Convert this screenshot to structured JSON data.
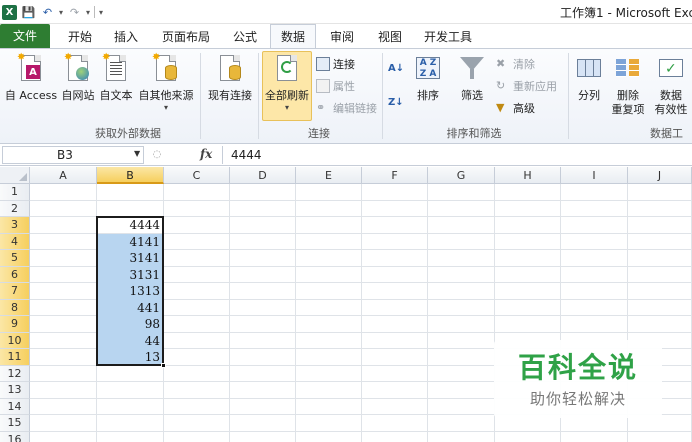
{
  "window": {
    "title": "工作簿1 - Microsoft Exce"
  },
  "qat": {
    "logo_letter": "X"
  },
  "tabs": [
    {
      "label": "文件",
      "kind": "file"
    },
    {
      "label": "开始"
    },
    {
      "label": "插入"
    },
    {
      "label": "页面布局"
    },
    {
      "label": "公式"
    },
    {
      "label": "数据",
      "active": true
    },
    {
      "label": "审阅"
    },
    {
      "label": "视图"
    },
    {
      "label": "开发工具"
    }
  ],
  "ribbon": {
    "external": {
      "access": "自 Access",
      "web": "自网站",
      "text": "自文本",
      "other": "自其他来源",
      "existing": "现有连接",
      "group": "获取外部数据"
    },
    "connections": {
      "refresh_all": "全部刷新",
      "connections": "连接",
      "properties": "属性",
      "edit_links": "编辑链接",
      "group": "连接"
    },
    "sort_filter": {
      "sort": "排序",
      "filter": "筛选",
      "clear": "清除",
      "reapply": "重新应用",
      "advanced": "高级",
      "group": "排序和筛选"
    },
    "data_tools": {
      "text_to_columns": "分列",
      "remove_duplicates_1": "删除",
      "remove_duplicates_2": "重复项",
      "validation_1": "数据",
      "validation_2": "有效性",
      "group": "数据工"
    }
  },
  "formula_bar": {
    "name_box": "B3",
    "fx": "fx",
    "value": "4444"
  },
  "sheet": {
    "columns": [
      "A",
      "B",
      "C",
      "D",
      "E",
      "F",
      "G",
      "H",
      "I",
      "J"
    ],
    "rows": [
      "1",
      "2",
      "3",
      "4",
      "5",
      "6",
      "7",
      "8",
      "9",
      "10",
      "11",
      "12",
      "13",
      "14",
      "15",
      "16"
    ],
    "selected_column": "B",
    "selected_rows": [
      "3",
      "4",
      "5",
      "6",
      "7",
      "8",
      "9",
      "10",
      "11"
    ],
    "column_b_values": [
      "",
      "",
      "4444",
      "4141",
      "3141",
      "3131",
      "1313",
      "441",
      "98",
      "44",
      "13"
    ]
  },
  "watermark": {
    "title": "百科全说",
    "subtitle": "助你轻松解决"
  },
  "colors": {
    "file_tab": "#2e7d32",
    "selection_fill": "#b8d5f0",
    "header_selected": "#f6cf5e",
    "watermark_green": "#2fa247"
  }
}
